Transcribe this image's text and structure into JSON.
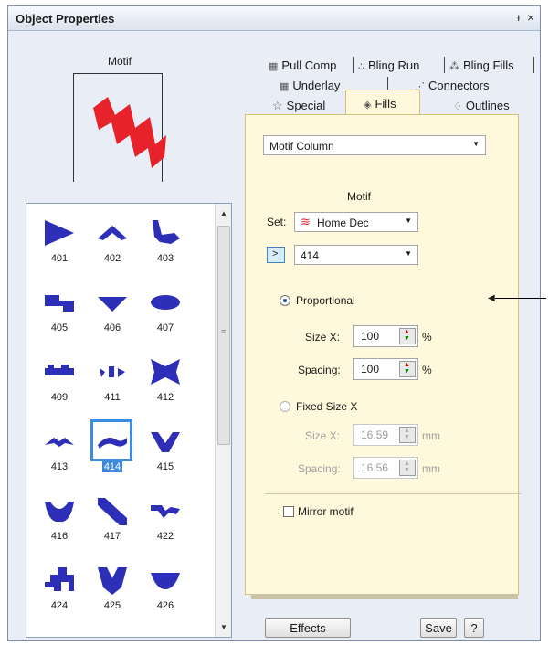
{
  "window": {
    "title": "Object Properties",
    "pin_glyph": "ᵻ",
    "close_glyph": "×"
  },
  "preview": {
    "label": "Motif"
  },
  "gallery": {
    "items": [
      {
        "num": "401",
        "icon": "triangle-right-motif"
      },
      {
        "num": "402",
        "icon": "chevron-up-motif"
      },
      {
        "num": "403",
        "icon": "swoosh-motif"
      },
      {
        "num": "405",
        "icon": "step-motif"
      },
      {
        "num": "406",
        "icon": "triangle-down-motif"
      },
      {
        "num": "407",
        "icon": "ellipse-motif"
      },
      {
        "num": "409",
        "icon": "bar-motif"
      },
      {
        "num": "411",
        "icon": "dots-motif"
      },
      {
        "num": "412",
        "icon": "bowtie-motif"
      },
      {
        "num": "413",
        "icon": "wings-motif"
      },
      {
        "num": "414",
        "icon": "wave-motif",
        "selected": true
      },
      {
        "num": "415",
        "icon": "v-motif"
      },
      {
        "num": "416",
        "icon": "bowl-motif"
      },
      {
        "num": "417",
        "icon": "diagonal-band-motif"
      },
      {
        "num": "422",
        "icon": "squiggle-motif"
      },
      {
        "num": "424",
        "icon": "steps-motif"
      },
      {
        "num": "425",
        "icon": "heart-v-motif"
      },
      {
        "num": "426",
        "icon": "half-disc-motif"
      }
    ],
    "scroll_up": "▲",
    "scroll_down": "▼",
    "grip": "≡"
  },
  "tabs": {
    "pull_comp": "Pull Comp",
    "bling_run": "Bling Run",
    "bling_fills": "Bling Fills",
    "underlay": "Underlay",
    "connectors": "Connectors",
    "special": "Special",
    "fills": "Fills",
    "outlines": "Outlines"
  },
  "fill": {
    "type_value": "Motif Column",
    "motif_heading": "Motif",
    "set_label": "Set:",
    "set_value": "Home Dec",
    "pattern_button": ">",
    "pattern_value": "414",
    "proportional_label": "Proportional",
    "prop_size_label": "Size X:",
    "prop_size_value": "100",
    "prop_size_unit": "%",
    "prop_spacing_label": "Spacing:",
    "prop_spacing_value": "100",
    "prop_spacing_unit": "%",
    "fixed_label": "Fixed Size X",
    "fixed_size_label": "Size X:",
    "fixed_size_value": "16.59",
    "fixed_size_unit": "mm",
    "fixed_spacing_label": "Spacing:",
    "fixed_spacing_value": "16.56",
    "fixed_spacing_unit": "mm",
    "mirror_label": "Mirror motif"
  },
  "footer": {
    "effects": "Effects",
    "save": "Save",
    "help": "?"
  },
  "colors": {
    "motif_blue": "#2d2fb8",
    "preview_red": "#e8222a",
    "selection_blue": "#3b8de0",
    "panel_bg": "#fff8dc"
  }
}
